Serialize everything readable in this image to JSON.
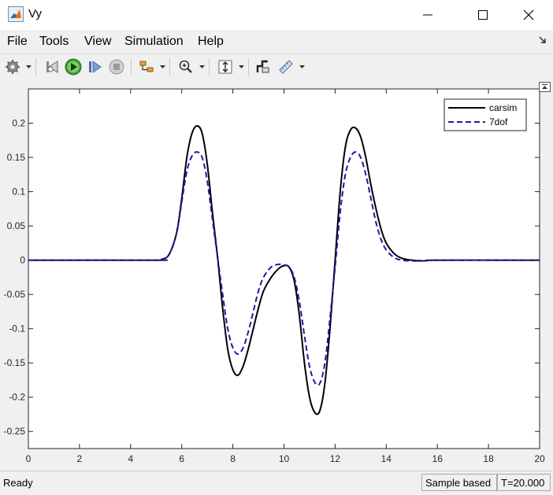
{
  "window": {
    "title": "Vy",
    "icons": {
      "app": "matlab-icon",
      "minimize": "minimize-icon",
      "maximize": "maximize-icon",
      "close": "close-icon"
    }
  },
  "menu": {
    "items": [
      {
        "name": "file",
        "label": "File"
      },
      {
        "name": "tools",
        "label": "Tools"
      },
      {
        "name": "view",
        "label": "View"
      },
      {
        "name": "simulation",
        "label": "Simulation"
      },
      {
        "name": "help",
        "label": "Help"
      }
    ]
  },
  "toolbar": {
    "icons": [
      "settings-icon",
      "step-back-icon",
      "run-icon",
      "step-forward-icon",
      "stop-icon",
      "signal-select-icon",
      "zoom-icon",
      "autoscale-icon",
      "highlight-block-icon",
      "measure-icon"
    ]
  },
  "status": {
    "ready": "Ready",
    "sample_mode": "Sample based",
    "time": "T=20.000"
  },
  "colors": {
    "carsim": "#000000",
    "7dof": "#1a1aa8",
    "grid_frame": "#262626"
  },
  "chart_data": {
    "type": "line",
    "title": "",
    "xlabel": "",
    "ylabel": "",
    "xlim": [
      0,
      20
    ],
    "ylim": [
      -0.275,
      0.25
    ],
    "xticks": [
      "0",
      "2",
      "4",
      "6",
      "8",
      "10",
      "12",
      "14",
      "16",
      "18",
      "20"
    ],
    "yticks": [
      "0.2",
      "0.15",
      "0.1",
      "0.05",
      "0",
      "-0.05",
      "-0.1",
      "-0.15",
      "-0.2",
      "-0.25"
    ],
    "grid": false,
    "legend_position": "top-right",
    "series": [
      {
        "name": "carsim",
        "style": "solid",
        "x": [
          0,
          5.0,
          5.2,
          5.5,
          5.8,
          6.0,
          6.2,
          6.4,
          6.6,
          6.8,
          7.0,
          7.2,
          7.4,
          7.6,
          7.8,
          8.0,
          8.2,
          8.4,
          8.6,
          8.8,
          9.0,
          9.2,
          9.5,
          9.8,
          10.0,
          10.2,
          10.4,
          10.6,
          10.8,
          11.0,
          11.2,
          11.4,
          11.6,
          11.8,
          12.0,
          12.2,
          12.4,
          12.6,
          12.8,
          13.0,
          13.2,
          13.4,
          13.6,
          13.8,
          14.0,
          14.3,
          14.6,
          15.0,
          15.5,
          16.0,
          20
        ],
        "y": [
          0,
          0,
          0.001,
          0.008,
          0.04,
          0.09,
          0.15,
          0.185,
          0.196,
          0.185,
          0.14,
          0.07,
          0.005,
          -0.07,
          -0.13,
          -0.16,
          -0.168,
          -0.155,
          -0.13,
          -0.1,
          -0.07,
          -0.045,
          -0.025,
          -0.012,
          -0.008,
          -0.01,
          -0.03,
          -0.08,
          -0.15,
          -0.2,
          -0.222,
          -0.22,
          -0.18,
          -0.1,
          0.0,
          0.1,
          0.165,
          0.19,
          0.193,
          0.18,
          0.15,
          0.11,
          0.075,
          0.045,
          0.025,
          0.01,
          0.003,
          0.0,
          -0.001,
          0,
          0
        ]
      },
      {
        "name": "7dof",
        "style": "dashed",
        "x": [
          0,
          5.0,
          5.2,
          5.5,
          5.8,
          6.0,
          6.2,
          6.4,
          6.6,
          6.8,
          7.0,
          7.2,
          7.4,
          7.6,
          7.8,
          8.0,
          8.2,
          8.4,
          8.6,
          8.8,
          9.0,
          9.2,
          9.5,
          9.8,
          10.0,
          10.2,
          10.4,
          10.6,
          10.8,
          11.0,
          11.2,
          11.4,
          11.6,
          11.8,
          12.0,
          12.2,
          12.4,
          12.6,
          12.8,
          13.0,
          13.2,
          13.4,
          13.6,
          13.8,
          14.0,
          14.3,
          14.6,
          15.0,
          15.5,
          16.0,
          20
        ],
        "y": [
          0,
          0,
          0.001,
          0.008,
          0.04,
          0.085,
          0.13,
          0.152,
          0.158,
          0.15,
          0.115,
          0.06,
          0.005,
          -0.05,
          -0.1,
          -0.128,
          -0.137,
          -0.128,
          -0.105,
          -0.075,
          -0.045,
          -0.025,
          -0.01,
          -0.006,
          -0.007,
          -0.01,
          -0.025,
          -0.06,
          -0.11,
          -0.155,
          -0.178,
          -0.18,
          -0.15,
          -0.085,
          -0.01,
          0.07,
          0.125,
          0.15,
          0.158,
          0.15,
          0.125,
          0.09,
          0.055,
          0.03,
          0.015,
          0.004,
          0.0,
          -0.001,
          -0.001,
          0,
          0
        ]
      }
    ]
  }
}
